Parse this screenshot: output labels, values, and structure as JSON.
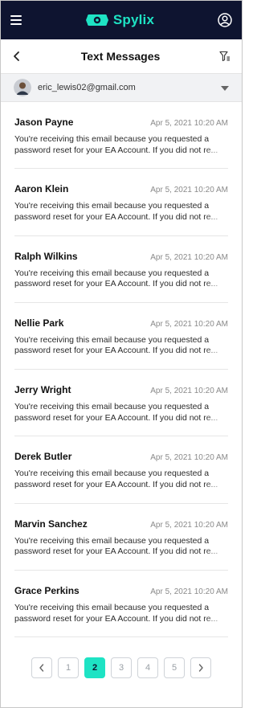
{
  "header": {
    "brand_name": "Spylix",
    "brand_color": "#1ee3c4",
    "bar_color": "#0e1430",
    "menu_icon": "hamburger-menu-icon",
    "profile_icon": "user-circle-icon"
  },
  "page": {
    "title": "Text Messages",
    "back_icon": "chevron-left-icon",
    "filter_icon": "filter-icon"
  },
  "account": {
    "email": "eric_lewis02@gmail.com",
    "dropdown_icon": "caret-down-icon"
  },
  "messages": [
    {
      "sender": "Jason Payne",
      "time": "Apr 5, 2021 10:20 AM",
      "line1": "You're receiving this email because you requested a",
      "line2": "password reset for your EA Account. If you did not  re..."
    },
    {
      "sender": "Aaron Klein",
      "time": "Apr 5, 2021 10:20 AM",
      "line1": "You're receiving this email because you requested a",
      "line2": "password reset for your EA Account. If you did not  re..."
    },
    {
      "sender": "Ralph Wilkins",
      "time": "Apr 5, 2021 10:20 AM",
      "line1": "You're receiving this email because you requested a",
      "line2": "password reset for your EA Account. If you did not  re..."
    },
    {
      "sender": "Nellie Park",
      "time": "Apr 5, 2021 10:20 AM",
      "line1": "You're receiving this email because you requested a",
      "line2": "password reset for your EA Account. If you did not  re..."
    },
    {
      "sender": "Jerry Wright",
      "time": "Apr 5, 2021 10:20 AM",
      "line1": "You're receiving this email because you requested a",
      "line2": "password reset for your EA Account. If you did not  re..."
    },
    {
      "sender": "Derek Butler",
      "time": "Apr 5, 2021 10:20 AM",
      "line1": "You're receiving this email because you requested a",
      "line2": "password reset for your EA Account. If you did not  re..."
    },
    {
      "sender": "Marvin Sanchez",
      "time": "Apr 5, 2021 10:20 AM",
      "line1": "You're receiving this email because you requested a",
      "line2": "password reset for your EA Account. If you did not  re..."
    },
    {
      "sender": "Grace Perkins",
      "time": "Apr 5, 2021 10:20 AM",
      "line1": "You're receiving this email because you requested a",
      "line2": "password reset for your EA Account. If you did not  re..."
    }
  ],
  "pagination": {
    "pages": [
      "1",
      "2",
      "3",
      "4",
      "5"
    ],
    "current": "2",
    "prev_icon": "chevron-left-icon",
    "next_icon": "chevron-right-icon"
  }
}
